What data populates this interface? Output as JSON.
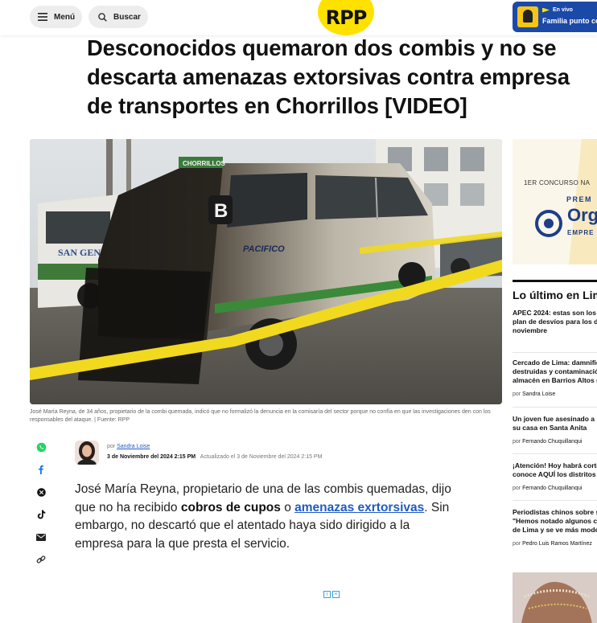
{
  "header": {
    "menu_label": "Menú",
    "search_label": "Buscar",
    "logo_text": "RPP",
    "live": {
      "status": "En vivo",
      "show": "Familia punto com"
    }
  },
  "article": {
    "title": "Desconocidos quemaron dos combis y no se descarta amenazas extorsivas contra empresa de transportes en Chorrillos [VIDEO]",
    "caption": "José María Reyna, de 34 años, propietario de la combi quemada, indicó que no formalizó la denuncia en la comisaría del sector porque no confía en que las investigaciones den con los responsables del ataque.  | Fuente: RPP",
    "image_text": {
      "bus_route_sign": "CHORRILLOS",
      "bus_company": "PACIFICO",
      "bus_letter": "B",
      "other_bus": "SAN GENARO"
    },
    "author": {
      "prefix": "por",
      "name": "Sandra Loise"
    },
    "published": "3 de Noviembre del 2024 2:15 PM",
    "updated": "Actualizado el 3 de Noviembre del 2024 2:15 PM",
    "body": {
      "part1": "José María Reyna, propietario de una de las combis quemadas, dijo que no ha recibido ",
      "bold1": "cobros de cupos",
      "part2": " o ",
      "link1": "amenazas exrtorsivas",
      "part3": ". Sin embargo, no descartó que el atentado haya sido dirigido a la empresa para la que presta el servicio."
    }
  },
  "share": {
    "icons": [
      "whatsapp-icon",
      "facebook-icon",
      "x-icon",
      "tiktok-icon",
      "email-icon",
      "link-icon"
    ],
    "colors": {
      "whatsapp": "#25d366",
      "facebook": "#1877f2"
    }
  },
  "sidebar": {
    "ad": {
      "line1": "1ER CONCURSO NA",
      "line2": "PREM",
      "line3": "Org",
      "line4": "EMPRE"
    },
    "latest_title": "Lo último en Lim",
    "items": [
      {
        "title_lines": [
          "APEC 2024: estas son los c",
          "plan de desvíos para los dí",
          "noviembre"
        ]
      },
      {
        "title_lines": [
          "Cercado de Lima: damnific",
          "destruidas y contaminació",
          "almacén en Barrios Altos (V"
        ],
        "by_prefix": "por",
        "by_name": "Sandra Loise"
      },
      {
        "title_lines": [
          "Un joven fue asesinado a b",
          "su casa en Santa Anita"
        ],
        "by_prefix": "por",
        "by_name": "Fernando Chuquillanqui"
      },
      {
        "title_lines": [
          "¡Atención! Hoy habrá corte",
          "conoce AQUÍ los distritos y"
        ],
        "by_prefix": "por",
        "by_name": "Fernando Chuquillanqui"
      },
      {
        "title_lines": [
          "Periodistas chinos sobre su",
          "\"Hemos notado algunos ca",
          "de Lima y se ve más moder"
        ],
        "by_prefix": "por",
        "by_name": "Pedro Luis Ramos Martínez"
      }
    ]
  },
  "colors": {
    "brand_yellow": "#ffe100",
    "live_blue": "#1b49a8",
    "link_blue": "#1f5bc4"
  }
}
